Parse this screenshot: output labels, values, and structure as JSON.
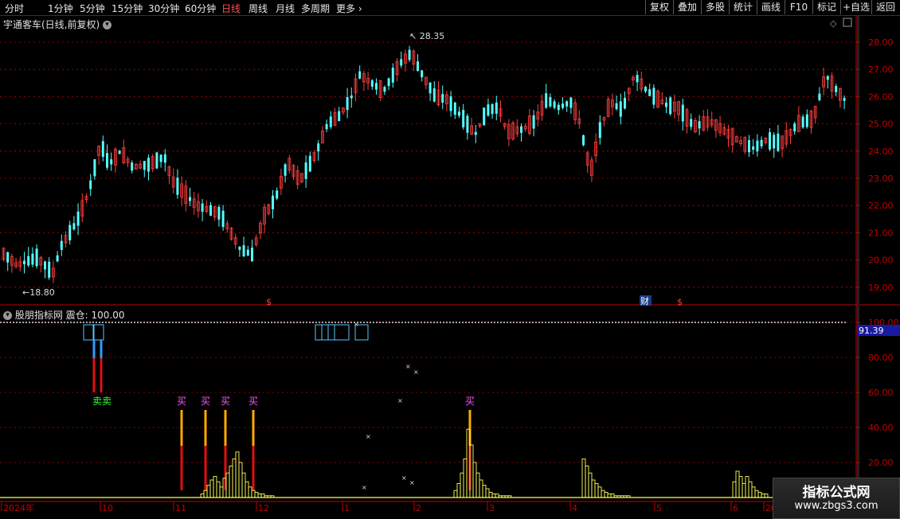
{
  "toolbar": {
    "periods": [
      "分时",
      "1分钟",
      "5分钟",
      "15分钟",
      "30分钟",
      "60分钟",
      "日线",
      "周线",
      "月线",
      "多周期",
      "更多"
    ],
    "active": "日线",
    "buttons": [
      "复权",
      "叠加",
      "多股",
      "统计",
      "画线",
      "F10",
      "标记",
      "+自选",
      "返回"
    ]
  },
  "main_chart": {
    "title": "宇通客车(日线,前复权)",
    "high_label": "28.35",
    "low_label": "18.80",
    "y_ticks": [
      "28.00",
      "27.00",
      "26.00",
      "25.00",
      "24.00",
      "23.00",
      "22.00",
      "21.00",
      "20.00",
      "19.00"
    ],
    "markers": [
      "$",
      "财",
      "$"
    ]
  },
  "indicator": {
    "title": "股朋指标网",
    "value_label": "震仓: 100.00",
    "current_value": "91.39",
    "y_ticks": [
      "100.00",
      "80.00",
      "60.00",
      "40.00",
      "20.00"
    ],
    "sell_label": "卖卖",
    "buy_label": "买"
  },
  "x_axis": {
    "labels": [
      "2024年",
      "10",
      "11",
      "12",
      "1",
      "2",
      "3",
      "4",
      "5",
      "6",
      "20"
    ]
  },
  "watermark": {
    "title": "指标公式网",
    "url": "www.zbgs3.com"
  },
  "colors": {
    "up": "#ff3c3c",
    "down": "#54ffff",
    "axis": "#c00000",
    "yellow": "#ffff55",
    "buy_label": "#ff55ff",
    "sell_label": "#33ff33"
  }
}
